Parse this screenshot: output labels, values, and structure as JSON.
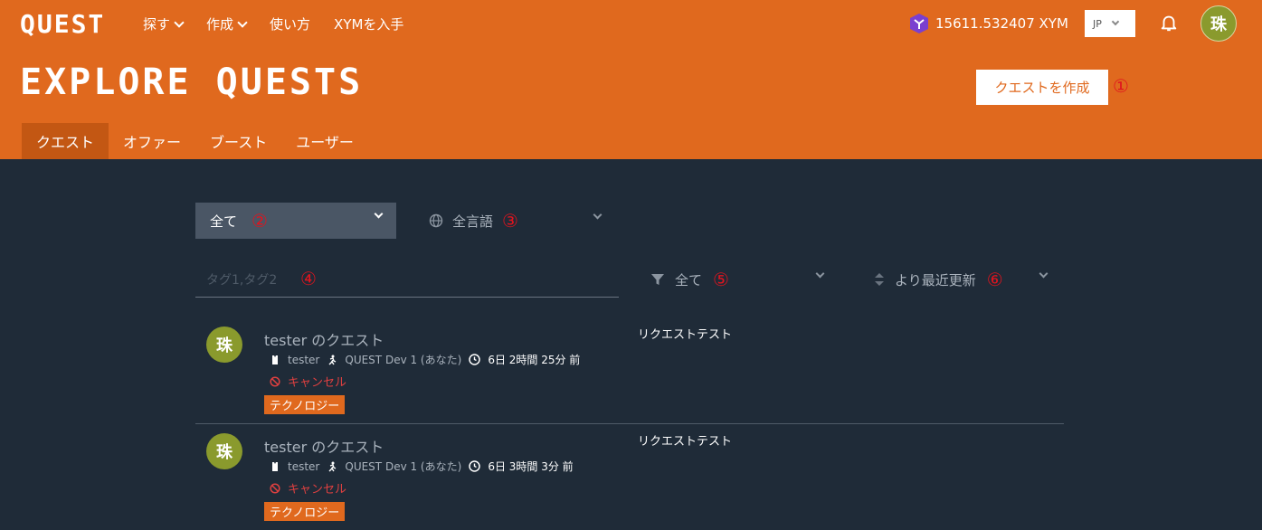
{
  "header": {
    "logo": "QUEST",
    "nav": [
      {
        "label": "探す",
        "has_dropdown": true
      },
      {
        "label": "作成",
        "has_dropdown": true
      },
      {
        "label": "使い方",
        "has_dropdown": false
      },
      {
        "label": "XYMを入手",
        "has_dropdown": false
      }
    ],
    "balance": "15611.532407 XYM",
    "language": "JP",
    "user_avatar": "珠"
  },
  "page": {
    "title": "EXPLORE QUESTS",
    "create_button": "クエストを作成",
    "tabs": [
      "クエスト",
      "オファー",
      "ブースト",
      "ユーザー"
    ],
    "active_tab": "クエスト"
  },
  "markers": [
    "①",
    "②",
    "③",
    "④",
    "⑤",
    "⑥"
  ],
  "filters": {
    "category": "全て",
    "language": "全言語",
    "tag_placeholder": "タグ1,タグ2",
    "status": "全て",
    "sort": "より最近更新"
  },
  "quests": [
    {
      "avatar": "珠",
      "title": "tester のクエスト",
      "requester": "tester",
      "worker": "QUEST Dev 1 (あなた)",
      "time": "6日 2時間 25分 前",
      "status": "キャンセル",
      "tag": "テクノロジー",
      "request": "リクエストテスト"
    },
    {
      "avatar": "珠",
      "title": "tester のクエスト",
      "requester": "tester",
      "worker": "QUEST Dev 1 (あなた)",
      "time": "6日 3時間 3分 前",
      "status": "キャンセル",
      "tag": "テクノロジー",
      "request": "リクエストテスト"
    }
  ],
  "colors": {
    "header_bg": "#e0691e",
    "active_tab_bg": "#c35713",
    "body_bg": "#1f2b38",
    "cancel_red": "#e04040",
    "marker_red": "#e0141e"
  }
}
